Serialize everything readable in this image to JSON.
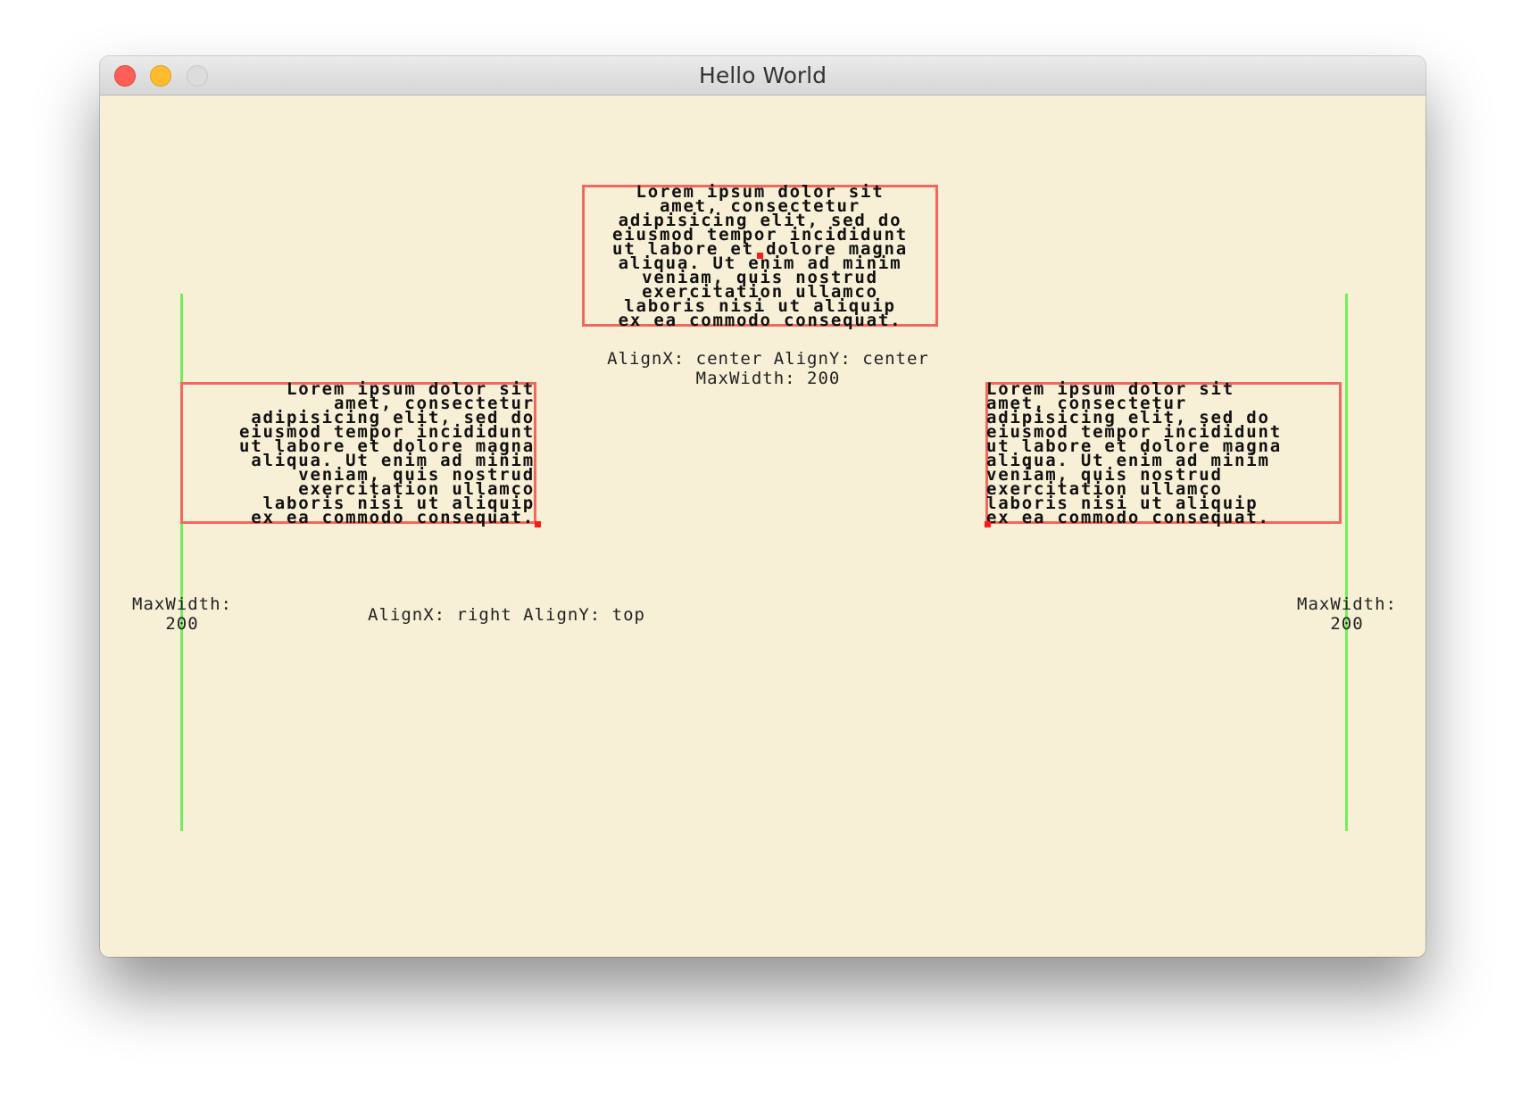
{
  "window": {
    "title": "Hello World"
  },
  "colors": {
    "background": "#f7f0d6",
    "box_border": "#f2685e",
    "guide_line": "#6ef05b",
    "anchor_dot": "#ff1a1a",
    "text": "#111111"
  },
  "lorem_lines": [
    "Lorem ipsum dolor sit",
    "amet, consectetur",
    "adipisicing elit, sed do",
    "eiusmod tempor incididunt",
    "ut labore et dolore magna",
    "aliqua. Ut enim ad minim",
    "veniam, quis nostrud",
    "exercitation ullamco",
    "laboris nisi ut aliquip",
    "ex ea commodo consequat."
  ],
  "top_box": {
    "align_x": "center",
    "align_y": "center",
    "label_line1": "AlignX: center AlignY: center",
    "label_line2": "MaxWidth: 200"
  },
  "left_box": {
    "align_x": "right",
    "align_y": "top",
    "label": "AlignX: right AlignY: top",
    "maxwidth_line1": "MaxWidth:",
    "maxwidth_line2": "200"
  },
  "right_box": {
    "align_x": "left",
    "maxwidth_line1": "MaxWidth:",
    "maxwidth_line2": "200"
  }
}
